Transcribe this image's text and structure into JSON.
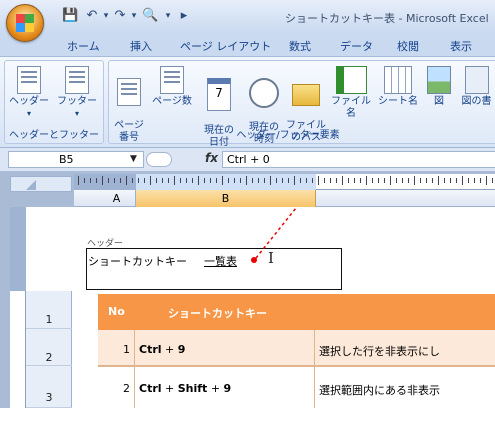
{
  "window": {
    "title": "ショートカットキー表 - Microsoft Excel"
  },
  "quick_access": {
    "save_icon": "save-icon",
    "undo_icon": "undo-icon",
    "redo_icon": "redo-icon",
    "preview_icon": "print-preview-icon"
  },
  "tabs": [
    {
      "label": "ホーム"
    },
    {
      "label": "挿入"
    },
    {
      "label": "ページ レイアウト"
    },
    {
      "label": "数式"
    },
    {
      "label": "データ"
    },
    {
      "label": "校閲"
    },
    {
      "label": "表示"
    }
  ],
  "ribbon": {
    "group1": {
      "label": "ヘッダーとフッター",
      "header": "ヘッダー",
      "footer": "フッター"
    },
    "group2": {
      "label": "ヘッダー/フッター要素",
      "page_number": "ページ\n番号",
      "page_count": "ページ数",
      "current_date": "現在の\n日付",
      "current_time": "現在の\n時刻",
      "file_path": "ファイル\nのパス",
      "file_name": "ファイル名",
      "sheet_name": "シート名",
      "picture": "図",
      "picture_format": "図の書"
    }
  },
  "formula_bar": {
    "name_box": "B5",
    "fx": "fx",
    "formula": "Ctrl + 0"
  },
  "columns": [
    "A",
    "B"
  ],
  "rows": [
    "1",
    "2",
    "3"
  ],
  "header_area": {
    "label": "ヘッダー",
    "text": "ショートカットキー",
    "link_text": "一覧表"
  },
  "table": {
    "headers": {
      "no": "No",
      "key": "ショートカットキー"
    },
    "rows": [
      {
        "no": "1",
        "key_a": "Ctrl",
        "plus1": " + ",
        "key_b": "9",
        "desc": "選択した行を非表示にし"
      },
      {
        "no": "2",
        "key_a": "Ctrl",
        "plus1": " + ",
        "key_b": "Shift",
        "plus2": " + ",
        "key_c": "9",
        "desc": "選択範囲内にある非表示"
      }
    ]
  },
  "colors": {
    "accent_orange": "#f79646",
    "row_fill": "#fde9d9",
    "ribbon_blue": "#15428b"
  }
}
